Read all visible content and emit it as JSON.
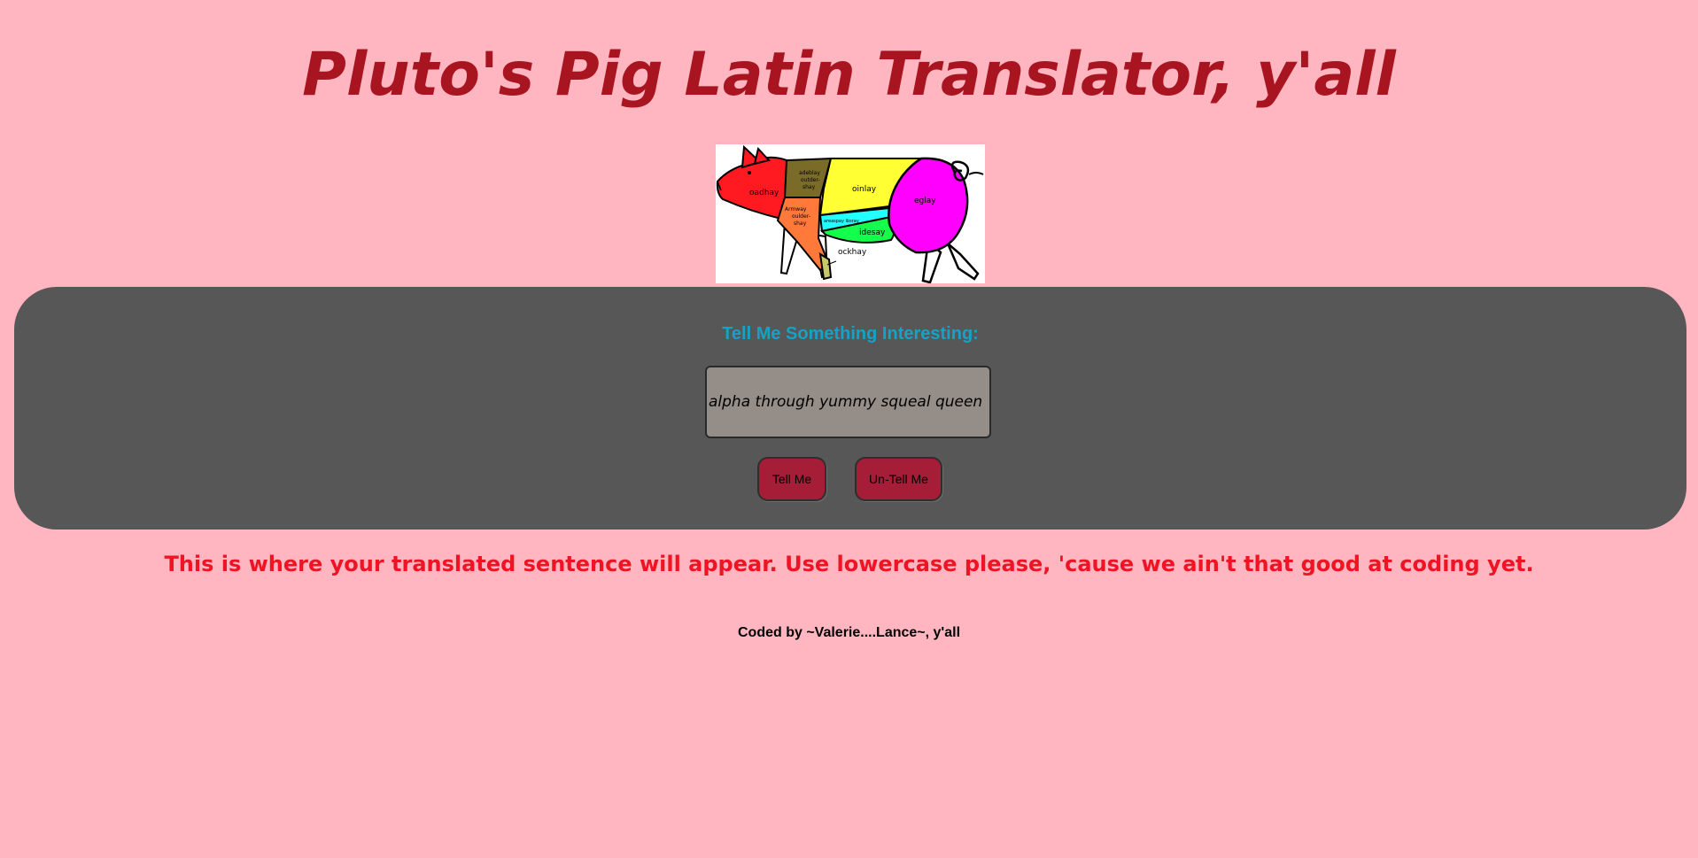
{
  "page": {
    "title": "Pluto's Pig Latin Translator, y'all",
    "background_color": "#ffb6c1",
    "title_color": "#a8141f"
  },
  "pig_image": {
    "icon": "pig-butcher-chart-image",
    "cuts": {
      "head": "oadhay",
      "shoulder": "adeblay outder-shay",
      "loin": "oinlay",
      "ham": "eglay",
      "arm": "Armway oulder-shay",
      "spare_ribs": "areaspay ibsray",
      "belly": "idesay",
      "hock": "ockhay"
    }
  },
  "form": {
    "panel_color": "#575757",
    "prompt_label": "Tell Me Something Interesting:",
    "prompt_color": "#14a3c7",
    "input_value": "alpha through yummy squeal queen fry",
    "input_placeholder": "",
    "tell_button_label": "Tell Me",
    "untell_button_label": "Un-Tell Me",
    "button_color": "#a51d37"
  },
  "output": {
    "text": "This is where your translated sentence will appear. Use lowercase please, 'cause we ain't that good at coding yet.",
    "color": "#ee1423"
  },
  "footer": {
    "text": "Coded by ~Valerie....Lance~, y'all"
  }
}
